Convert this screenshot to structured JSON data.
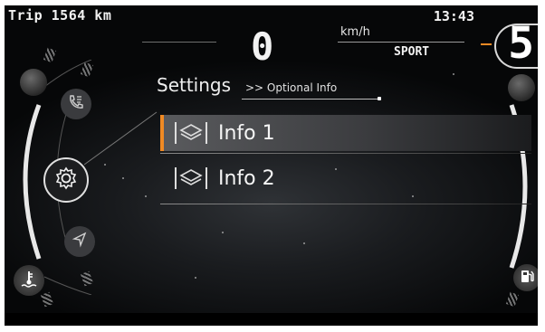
{
  "status_bar": {
    "trip": "Trip 1564 km",
    "clock": "13:43",
    "speed": "0",
    "speed_unit": "km/h",
    "drive_mode": "SPORT",
    "gear": "5"
  },
  "settings": {
    "title": "Settings",
    "breadcrumb": ">> Optional Info"
  },
  "menu": {
    "items": [
      {
        "label": "Info 1",
        "selected": true
      },
      {
        "label": "Info 2",
        "selected": false
      }
    ]
  },
  "side_icons": [
    "phone-icon",
    "settings-gear-icon",
    "navigation-arrow-icon"
  ],
  "gauges": {
    "left": "coolant-temperature-icon",
    "right": "fuel-pump-icon"
  },
  "colors": {
    "accent": "#f08a24",
    "background": "#0b0c0e",
    "text": "#f2f2f2"
  }
}
